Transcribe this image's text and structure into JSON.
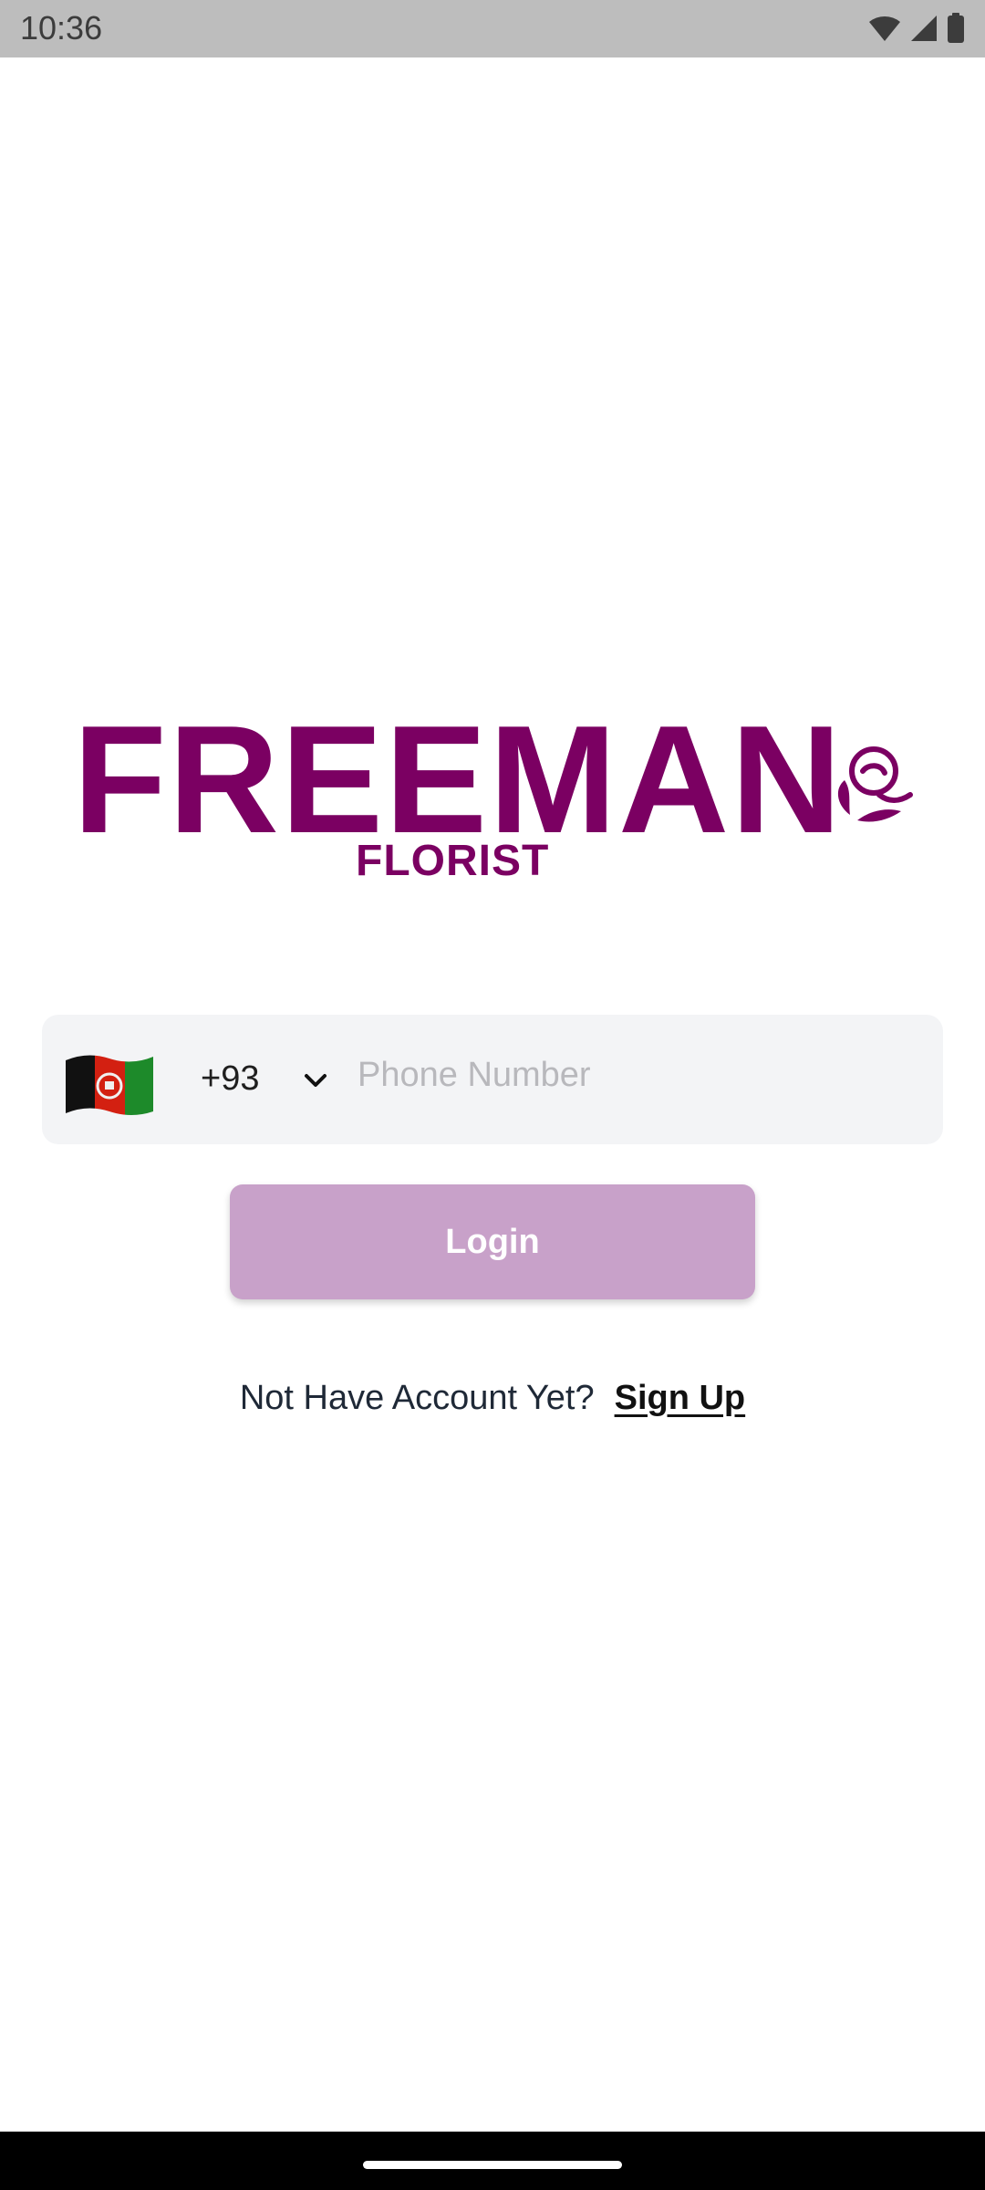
{
  "status_bar": {
    "time": "10:36",
    "icons": [
      "wifi-icon",
      "cellular-signal-icon",
      "battery-icon"
    ]
  },
  "logo": {
    "main_text": "FREEMAN",
    "sub_text": "FLORIST",
    "icon": "rose-icon",
    "color": "#7b0062"
  },
  "phone_field": {
    "country_flag": "afghanistan-flag-icon",
    "country_code": "+93",
    "dropdown_icon": "chevron-down-icon",
    "value": "",
    "placeholder": "Phone Number"
  },
  "login": {
    "label": "Login",
    "color": "#c8a1c9"
  },
  "signup": {
    "prompt": "Not Have Account Yet?",
    "link_label": "Sign Up"
  },
  "colors": {
    "accent": "#7b0062",
    "field_background": "#f3f4f6"
  }
}
